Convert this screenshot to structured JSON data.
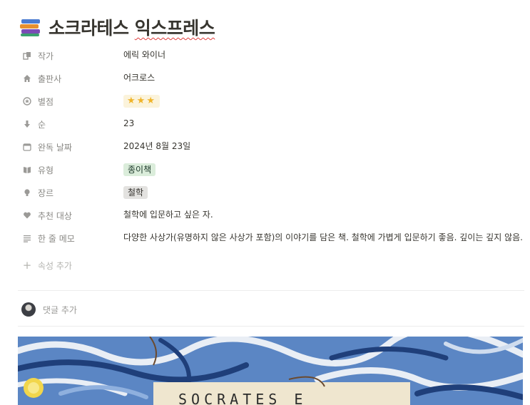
{
  "title": {
    "icon": "books-icon",
    "text_plain": "소크라테스 ",
    "text_underlined": "익스프레스"
  },
  "properties": [
    {
      "key": "author",
      "icon": "list-icon",
      "label": "작가",
      "value": "에릭 와이너"
    },
    {
      "key": "publisher",
      "icon": "home-icon",
      "label": "출판사",
      "value": "어크로스"
    },
    {
      "key": "rating",
      "icon": "star-circle-icon",
      "label": "별점",
      "value": "⭐⭐⭐",
      "stars": 3
    },
    {
      "key": "order",
      "icon": "arrow-down-icon",
      "label": "순",
      "value": "23"
    },
    {
      "key": "finished_date",
      "icon": "calendar-icon",
      "label": "완독 날짜",
      "value": "2024년 8월 23일"
    },
    {
      "key": "type",
      "icon": "book-open-icon",
      "label": "유형",
      "value": "종이책",
      "tag_color": "green"
    },
    {
      "key": "genre",
      "icon": "bulb-icon",
      "label": "장르",
      "value": "철학",
      "tag_color": "gray"
    },
    {
      "key": "audience",
      "icon": "heart-icon",
      "label": "추천 대상",
      "value": "철학에 입문하고 싶은 자."
    },
    {
      "key": "memo",
      "icon": "text-lines-icon",
      "label": "한 줄 메모",
      "value": "다양한 사상가(유명하지 않은 사상가 포함)의 이야기를 담은 책. 철학에 가볍게 입문하기 좋음. 깊이는 깊지 않음."
    }
  ],
  "add_property": {
    "icon": "plus-icon",
    "label": "속성 추가"
  },
  "comment": {
    "label": "댓글 추가"
  },
  "cover": {
    "handwritten_text": "SOCRATES E",
    "colors": {
      "sky": "#5b86c4",
      "swirl": "#e9eef5",
      "dark": "#1f3f7a",
      "moon": "#f2d64b"
    }
  }
}
